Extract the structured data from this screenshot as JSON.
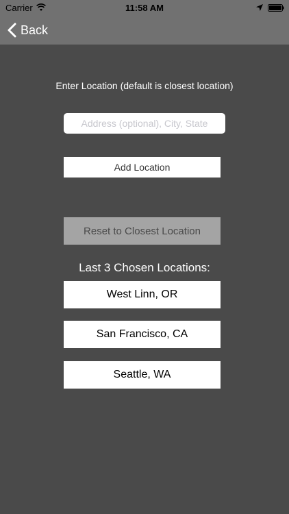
{
  "status": {
    "carrier": "Carrier",
    "time": "11:58 AM",
    "icons": [
      "wifi-icon",
      "location-arrow-icon",
      "battery-icon"
    ]
  },
  "nav": {
    "back_label": "Back"
  },
  "form": {
    "prompt": "Enter Location (default is closest location)",
    "address_placeholder": "Address (optional), City, State",
    "address_value": "",
    "add_label": "Add Location",
    "reset_label": "Reset to Closest Location"
  },
  "recent": {
    "heading": "Last 3 Chosen Locations:",
    "items": [
      "West Linn, OR",
      "San Francisco, CA",
      "Seattle, WA"
    ]
  },
  "colors": {
    "background": "#4a4a4a",
    "navbar": "#717171",
    "reset_button": "#a4a4a4",
    "button": "#ffffff"
  }
}
